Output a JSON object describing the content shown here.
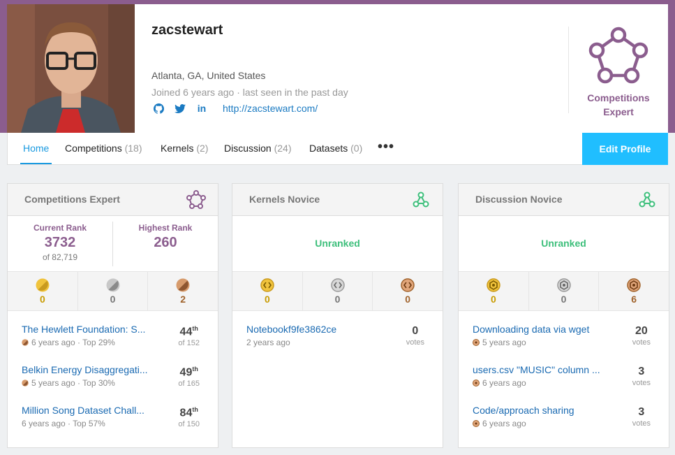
{
  "profile": {
    "username": "zacstewart",
    "location": "Atlanta, GA, United States",
    "joined": "Joined 6 years ago · last seen in the past day",
    "website": "http://zacstewart.com/",
    "tier": [
      "Competitions",
      "Expert"
    ]
  },
  "colors": {
    "brand": "#8b5d8e",
    "accent": "#20beff",
    "link": "#1a6ab2",
    "unranked": "#3dbf7b"
  },
  "nav": {
    "tabs": [
      {
        "label": "Home",
        "count": ""
      },
      {
        "label": "Competitions",
        "count": "(18)"
      },
      {
        "label": "Kernels",
        "count": "(2)"
      },
      {
        "label": "Discussion",
        "count": "(24)"
      },
      {
        "label": "Datasets",
        "count": "(0)"
      }
    ],
    "more": "•••",
    "edit": "Edit Profile"
  },
  "competitions": {
    "title": "Competitions Expert",
    "current_rank_label": "Current Rank",
    "current_rank": "3732",
    "of_total": "of 82,719",
    "highest_rank_label": "Highest Rank",
    "highest_rank": "260",
    "medals": {
      "gold": "0",
      "silver": "0",
      "bronze": "2"
    },
    "items": [
      {
        "title": "The Hewlett Foundation: S...",
        "meta": "6 years ago · Top 29%",
        "rank": "44",
        "suffix": "th",
        "of": "of 152"
      },
      {
        "title": "Belkin Energy Disaggregati...",
        "meta": "5 years ago · Top 30%",
        "rank": "49",
        "suffix": "th",
        "of": "of 165"
      },
      {
        "title": "Million Song Dataset Chall...",
        "meta": "6 years ago · Top 57%",
        "rank": "84",
        "suffix": "th",
        "of": "of 150"
      }
    ]
  },
  "kernels": {
    "title": "Kernels Novice",
    "status": "Unranked",
    "medals": {
      "gold": "0",
      "silver": "0",
      "bronze": "0"
    },
    "items": [
      {
        "title": "Notebookf9fe3862ce",
        "meta": "2 years ago",
        "votes": "0",
        "votes_label": "votes"
      }
    ]
  },
  "discussion": {
    "title": "Discussion Novice",
    "status": "Unranked",
    "medals": {
      "gold": "0",
      "silver": "0",
      "bronze": "6"
    },
    "items": [
      {
        "title": "Downloading data via wget",
        "meta": "5 years ago",
        "votes": "20",
        "votes_label": "votes"
      },
      {
        "title": "users.csv \"MUSIC\" column ...",
        "meta": "6 years ago",
        "votes": "3",
        "votes_label": "votes"
      },
      {
        "title": "Code/approach sharing",
        "meta": "6 years ago",
        "votes": "3",
        "votes_label": "votes"
      }
    ]
  }
}
